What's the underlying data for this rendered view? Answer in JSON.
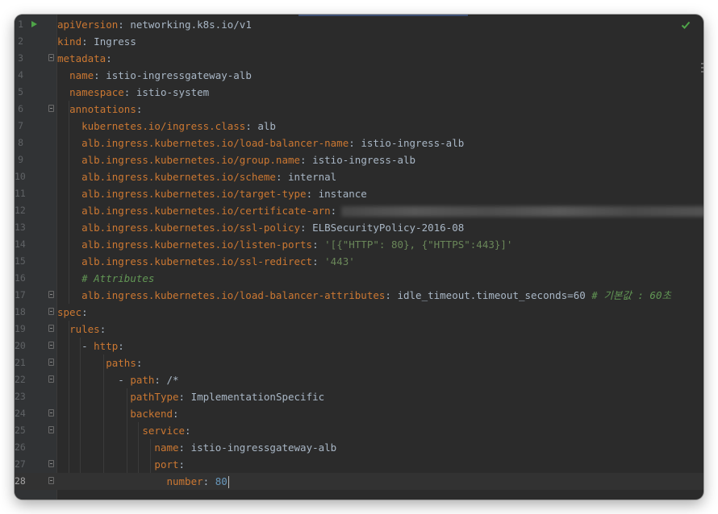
{
  "editor": {
    "lines": [
      {
        "n": "1",
        "parts": [
          {
            "t": "k",
            "text": "apiVersion"
          },
          {
            "t": "p",
            "text": ": "
          },
          {
            "t": "v",
            "text": "networking.k8s.io/v1"
          }
        ]
      },
      {
        "n": "2",
        "parts": [
          {
            "t": "k",
            "text": "kind"
          },
          {
            "t": "p",
            "text": ": "
          },
          {
            "t": "v",
            "text": "Ingress"
          }
        ]
      },
      {
        "n": "3",
        "parts": [
          {
            "t": "k",
            "text": "metadata"
          },
          {
            "t": "p",
            "text": ":"
          }
        ]
      },
      {
        "n": "4",
        "parts": [
          {
            "t": "p",
            "text": "  "
          },
          {
            "t": "k",
            "text": "name"
          },
          {
            "t": "p",
            "text": ": "
          },
          {
            "t": "v",
            "text": "istio-ingressgateway-alb"
          }
        ]
      },
      {
        "n": "5",
        "parts": [
          {
            "t": "p",
            "text": "  "
          },
          {
            "t": "k",
            "text": "namespace"
          },
          {
            "t": "p",
            "text": ": "
          },
          {
            "t": "v",
            "text": "istio-system"
          }
        ]
      },
      {
        "n": "6",
        "parts": [
          {
            "t": "p",
            "text": "  "
          },
          {
            "t": "k",
            "text": "annotations"
          },
          {
            "t": "p",
            "text": ":"
          }
        ]
      },
      {
        "n": "7",
        "parts": [
          {
            "t": "p",
            "text": "    "
          },
          {
            "t": "k",
            "text": "kubernetes.io/ingress.class"
          },
          {
            "t": "p",
            "text": ": "
          },
          {
            "t": "v",
            "text": "alb"
          }
        ]
      },
      {
        "n": "8",
        "parts": [
          {
            "t": "p",
            "text": "    "
          },
          {
            "t": "k",
            "text": "alb.ingress.kubernetes.io/load-balancer-name"
          },
          {
            "t": "p",
            "text": ": "
          },
          {
            "t": "v",
            "text": "istio-ingress-alb"
          }
        ]
      },
      {
        "n": "9",
        "parts": [
          {
            "t": "p",
            "text": "    "
          },
          {
            "t": "k",
            "text": "alb.ingress.kubernetes.io/group.name"
          },
          {
            "t": "p",
            "text": ": "
          },
          {
            "t": "v",
            "text": "istio-ingress-alb"
          }
        ]
      },
      {
        "n": "10",
        "parts": [
          {
            "t": "p",
            "text": "    "
          },
          {
            "t": "k",
            "text": "alb.ingress.kubernetes.io/scheme"
          },
          {
            "t": "p",
            "text": ": "
          },
          {
            "t": "v",
            "text": "internal"
          }
        ]
      },
      {
        "n": "11",
        "parts": [
          {
            "t": "p",
            "text": "    "
          },
          {
            "t": "k",
            "text": "alb.ingress.kubernetes.io/target-type"
          },
          {
            "t": "p",
            "text": ": "
          },
          {
            "t": "v",
            "text": "instance"
          }
        ]
      },
      {
        "n": "12",
        "parts": [
          {
            "t": "p",
            "text": "    "
          },
          {
            "t": "k",
            "text": "alb.ingress.kubernetes.io/certificate-arn"
          },
          {
            "t": "p",
            "text": ":"
          }
        ],
        "redacted": true
      },
      {
        "n": "13",
        "parts": [
          {
            "t": "p",
            "text": "    "
          },
          {
            "t": "k",
            "text": "alb.ingress.kubernetes.io/ssl-policy"
          },
          {
            "t": "p",
            "text": ": "
          },
          {
            "t": "v",
            "text": "ELBSecurityPolicy-2016-08"
          }
        ]
      },
      {
        "n": "14",
        "parts": [
          {
            "t": "p",
            "text": "    "
          },
          {
            "t": "k",
            "text": "alb.ingress.kubernetes.io/listen-ports"
          },
          {
            "t": "p",
            "text": ": "
          },
          {
            "t": "s",
            "text": "'[{\"HTTP\": 80}, {\"HTTPS\":443}]'"
          }
        ]
      },
      {
        "n": "15",
        "parts": [
          {
            "t": "p",
            "text": "    "
          },
          {
            "t": "k",
            "text": "alb.ingress.kubernetes.io/ssl-redirect"
          },
          {
            "t": "p",
            "text": ": "
          },
          {
            "t": "s",
            "text": "'443'"
          }
        ]
      },
      {
        "n": "16",
        "parts": [
          {
            "t": "p",
            "text": "    "
          },
          {
            "t": "c",
            "text": "# Attributes"
          }
        ]
      },
      {
        "n": "17",
        "parts": [
          {
            "t": "p",
            "text": "    "
          },
          {
            "t": "k",
            "text": "alb.ingress.kubernetes.io/load-balancer-attributes"
          },
          {
            "t": "p",
            "text": ": "
          },
          {
            "t": "v",
            "text": "idle_timeout.timeout_seconds=60 "
          },
          {
            "t": "c",
            "text": "# 기본값 : 60초"
          }
        ]
      },
      {
        "n": "18",
        "parts": [
          {
            "t": "k",
            "text": "spec"
          },
          {
            "t": "p",
            "text": ":"
          }
        ]
      },
      {
        "n": "19",
        "parts": [
          {
            "t": "p",
            "text": "  "
          },
          {
            "t": "k",
            "text": "rules"
          },
          {
            "t": "p",
            "text": ":"
          }
        ]
      },
      {
        "n": "20",
        "parts": [
          {
            "t": "p",
            "text": "    - "
          },
          {
            "t": "k",
            "text": "http"
          },
          {
            "t": "p",
            "text": ":"
          }
        ]
      },
      {
        "n": "21",
        "parts": [
          {
            "t": "p",
            "text": "        "
          },
          {
            "t": "k",
            "text": "paths"
          },
          {
            "t": "p",
            "text": ":"
          }
        ]
      },
      {
        "n": "22",
        "parts": [
          {
            "t": "p",
            "text": "          - "
          },
          {
            "t": "k",
            "text": "path"
          },
          {
            "t": "p",
            "text": ": "
          },
          {
            "t": "v",
            "text": "/*"
          }
        ]
      },
      {
        "n": "23",
        "parts": [
          {
            "t": "p",
            "text": "            "
          },
          {
            "t": "k",
            "text": "pathType"
          },
          {
            "t": "p",
            "text": ": "
          },
          {
            "t": "v",
            "text": "ImplementationSpecific"
          }
        ]
      },
      {
        "n": "24",
        "parts": [
          {
            "t": "p",
            "text": "            "
          },
          {
            "t": "k",
            "text": "backend"
          },
          {
            "t": "p",
            "text": ":"
          }
        ]
      },
      {
        "n": "25",
        "parts": [
          {
            "t": "p",
            "text": "              "
          },
          {
            "t": "k",
            "text": "service"
          },
          {
            "t": "p",
            "text": ":"
          }
        ]
      },
      {
        "n": "26",
        "parts": [
          {
            "t": "p",
            "text": "                "
          },
          {
            "t": "k",
            "text": "name"
          },
          {
            "t": "p",
            "text": ": "
          },
          {
            "t": "v",
            "text": "istio-ingressgateway-alb"
          }
        ]
      },
      {
        "n": "27",
        "parts": [
          {
            "t": "p",
            "text": "                "
          },
          {
            "t": "k",
            "text": "port"
          },
          {
            "t": "p",
            "text": ":"
          }
        ]
      },
      {
        "n": "28",
        "parts": [
          {
            "t": "p",
            "text": "                  "
          },
          {
            "t": "k",
            "text": "number"
          },
          {
            "t": "p",
            "text": ": "
          },
          {
            "t": "n",
            "text": "80"
          }
        ],
        "current": true
      }
    ],
    "fold_lines": [
      "3",
      "6",
      "17",
      "18",
      "19",
      "20",
      "21",
      "22",
      "24",
      "25",
      "27",
      "28"
    ],
    "status_icon": "check-icon",
    "run_icon": "run-icon",
    "colors": {
      "keyword": "#cc7832",
      "value": "#a9b7c6",
      "string": "#6a8759",
      "comment": "#629755",
      "number": "#6897bb",
      "background": "#2b2b2b"
    }
  }
}
